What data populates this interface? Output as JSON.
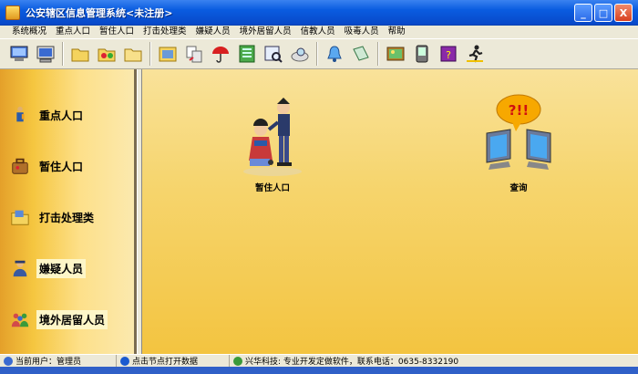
{
  "window": {
    "title": "公安辖区信息管理系统<未注册>",
    "min": "_",
    "max": "□",
    "close": "X"
  },
  "menu": [
    "系统概况",
    "重点人口",
    "暂住人口",
    "打击处理类",
    "嫌疑人员",
    "境外居留人员",
    "信教人员",
    "吸毒人员",
    "帮助"
  ],
  "toolbar": {
    "icons": [
      "monitor-icon",
      "computer-icon",
      "folder-icon",
      "folder-share-icon",
      "folder-open-icon",
      "people-folder-icon",
      "exchange-icon",
      "umbrella-icon",
      "ledger-icon",
      "table-search-icon",
      "search-plate-icon",
      "bell-icon",
      "notebook-icon",
      "picture-frame-icon",
      "handheld-icon",
      "help-book-icon",
      "exit-runner-icon"
    ]
  },
  "nav": [
    {
      "name": "nav-key-population",
      "label": "重点人口",
      "icon": "key-person-icon"
    },
    {
      "name": "nav-temporary-residents",
      "label": "暂住人口",
      "icon": "luggage-icon"
    },
    {
      "name": "nav-crackdown",
      "label": "打击处理类",
      "icon": "case-folder-icon"
    },
    {
      "name": "nav-suspects",
      "label": "嫌疑人员",
      "icon": "suspect-icon"
    },
    {
      "name": "nav-foreign-residents",
      "label": "境外居留人员",
      "icon": "group-people-icon"
    }
  ],
  "main": {
    "items": [
      {
        "label": "暂住人口"
      },
      {
        "label": "查询"
      }
    ],
    "query_bubble": "?!!"
  },
  "status": {
    "user": "当前用户：管理员",
    "hint": "点击节点打开数据",
    "company": "兴华科技: 专业开发定做软件，联系电话：0635-8332190"
  },
  "colors": {
    "titlebar": "#0a5ce0",
    "panel": "#f5c640",
    "bubble": "#f7a800"
  }
}
